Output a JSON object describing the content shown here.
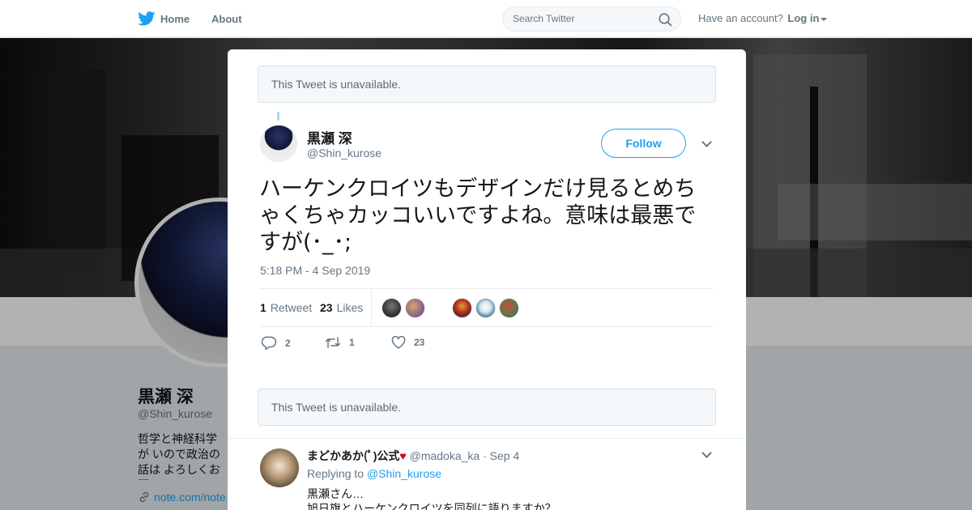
{
  "topbar": {
    "home_label": "Home",
    "about_label": "About",
    "search_placeholder": "Search Twitter",
    "have_account_text": "Have an account?",
    "login_label": "Log in"
  },
  "profile": {
    "name": "黒瀬 深",
    "handle": "@Shin_kurose",
    "bio": "哲学と神経科学が いので政治の話は よろしくお願いし",
    "link": "note.com/note"
  },
  "modal": {
    "unavailable_top": "This Tweet is unavailable.",
    "unavailable_bottom": "This Tweet is unavailable.",
    "tweet": {
      "author_name": "黒瀬 深",
      "author_handle": "@Shin_kurose",
      "follow_label": "Follow",
      "text": "ハーケンクロイツもデザインだけ見るとめちゃくちゃカッコいいですよね。意味は最悪ですが(･_･;",
      "timestamp": "5:18 PM - 4 Sep 2019",
      "stats": {
        "retweet_count": "1",
        "retweet_label": "Retweet",
        "like_count": "23",
        "like_label": "Likes"
      },
      "actions": {
        "reply_count": "2",
        "retweet_count": "1",
        "like_count": "23"
      }
    },
    "reply": {
      "author_name": "まどかあか(ﾟ)公式",
      "heart": "♥",
      "author_handle": "@madoka_ka",
      "separator": "·",
      "date": "Sep 4",
      "replying_prefix": "Replying to",
      "replying_to": "@Shin_kurose",
      "line1": "黒瀬さん…",
      "line2": "旭日旗とハーケンクロイツを同列に語りますか？"
    }
  },
  "colors": {
    "brand_blue": "#1da1f2",
    "text_primary": "#14171a",
    "text_secondary": "#657786",
    "border": "#e6ecf0"
  },
  "icons": [
    "twitter-bird-icon",
    "search-icon",
    "close-icon",
    "chevron-down-icon",
    "reply-icon",
    "retweet-icon",
    "heart-icon"
  ]
}
